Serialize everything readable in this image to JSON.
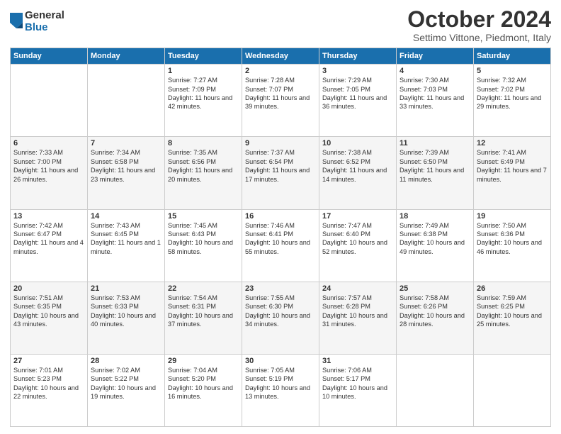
{
  "logo": {
    "general": "General",
    "blue": "Blue"
  },
  "title": "October 2024",
  "subtitle": "Settimo Vittone, Piedmont, Italy",
  "days_of_week": [
    "Sunday",
    "Monday",
    "Tuesday",
    "Wednesday",
    "Thursday",
    "Friday",
    "Saturday"
  ],
  "weeks": [
    [
      {
        "day": "",
        "sunrise": "",
        "sunset": "",
        "daylight": ""
      },
      {
        "day": "",
        "sunrise": "",
        "sunset": "",
        "daylight": ""
      },
      {
        "day": "1",
        "sunrise": "Sunrise: 7:27 AM",
        "sunset": "Sunset: 7:09 PM",
        "daylight": "Daylight: 11 hours and 42 minutes."
      },
      {
        "day": "2",
        "sunrise": "Sunrise: 7:28 AM",
        "sunset": "Sunset: 7:07 PM",
        "daylight": "Daylight: 11 hours and 39 minutes."
      },
      {
        "day": "3",
        "sunrise": "Sunrise: 7:29 AM",
        "sunset": "Sunset: 7:05 PM",
        "daylight": "Daylight: 11 hours and 36 minutes."
      },
      {
        "day": "4",
        "sunrise": "Sunrise: 7:30 AM",
        "sunset": "Sunset: 7:03 PM",
        "daylight": "Daylight: 11 hours and 33 minutes."
      },
      {
        "day": "5",
        "sunrise": "Sunrise: 7:32 AM",
        "sunset": "Sunset: 7:02 PM",
        "daylight": "Daylight: 11 hours and 29 minutes."
      }
    ],
    [
      {
        "day": "6",
        "sunrise": "Sunrise: 7:33 AM",
        "sunset": "Sunset: 7:00 PM",
        "daylight": "Daylight: 11 hours and 26 minutes."
      },
      {
        "day": "7",
        "sunrise": "Sunrise: 7:34 AM",
        "sunset": "Sunset: 6:58 PM",
        "daylight": "Daylight: 11 hours and 23 minutes."
      },
      {
        "day": "8",
        "sunrise": "Sunrise: 7:35 AM",
        "sunset": "Sunset: 6:56 PM",
        "daylight": "Daylight: 11 hours and 20 minutes."
      },
      {
        "day": "9",
        "sunrise": "Sunrise: 7:37 AM",
        "sunset": "Sunset: 6:54 PM",
        "daylight": "Daylight: 11 hours and 17 minutes."
      },
      {
        "day": "10",
        "sunrise": "Sunrise: 7:38 AM",
        "sunset": "Sunset: 6:52 PM",
        "daylight": "Daylight: 11 hours and 14 minutes."
      },
      {
        "day": "11",
        "sunrise": "Sunrise: 7:39 AM",
        "sunset": "Sunset: 6:50 PM",
        "daylight": "Daylight: 11 hours and 11 minutes."
      },
      {
        "day": "12",
        "sunrise": "Sunrise: 7:41 AM",
        "sunset": "Sunset: 6:49 PM",
        "daylight": "Daylight: 11 hours and 7 minutes."
      }
    ],
    [
      {
        "day": "13",
        "sunrise": "Sunrise: 7:42 AM",
        "sunset": "Sunset: 6:47 PM",
        "daylight": "Daylight: 11 hours and 4 minutes."
      },
      {
        "day": "14",
        "sunrise": "Sunrise: 7:43 AM",
        "sunset": "Sunset: 6:45 PM",
        "daylight": "Daylight: 11 hours and 1 minute."
      },
      {
        "day": "15",
        "sunrise": "Sunrise: 7:45 AM",
        "sunset": "Sunset: 6:43 PM",
        "daylight": "Daylight: 10 hours and 58 minutes."
      },
      {
        "day": "16",
        "sunrise": "Sunrise: 7:46 AM",
        "sunset": "Sunset: 6:41 PM",
        "daylight": "Daylight: 10 hours and 55 minutes."
      },
      {
        "day": "17",
        "sunrise": "Sunrise: 7:47 AM",
        "sunset": "Sunset: 6:40 PM",
        "daylight": "Daylight: 10 hours and 52 minutes."
      },
      {
        "day": "18",
        "sunrise": "Sunrise: 7:49 AM",
        "sunset": "Sunset: 6:38 PM",
        "daylight": "Daylight: 10 hours and 49 minutes."
      },
      {
        "day": "19",
        "sunrise": "Sunrise: 7:50 AM",
        "sunset": "Sunset: 6:36 PM",
        "daylight": "Daylight: 10 hours and 46 minutes."
      }
    ],
    [
      {
        "day": "20",
        "sunrise": "Sunrise: 7:51 AM",
        "sunset": "Sunset: 6:35 PM",
        "daylight": "Daylight: 10 hours and 43 minutes."
      },
      {
        "day": "21",
        "sunrise": "Sunrise: 7:53 AM",
        "sunset": "Sunset: 6:33 PM",
        "daylight": "Daylight: 10 hours and 40 minutes."
      },
      {
        "day": "22",
        "sunrise": "Sunrise: 7:54 AM",
        "sunset": "Sunset: 6:31 PM",
        "daylight": "Daylight: 10 hours and 37 minutes."
      },
      {
        "day": "23",
        "sunrise": "Sunrise: 7:55 AM",
        "sunset": "Sunset: 6:30 PM",
        "daylight": "Daylight: 10 hours and 34 minutes."
      },
      {
        "day": "24",
        "sunrise": "Sunrise: 7:57 AM",
        "sunset": "Sunset: 6:28 PM",
        "daylight": "Daylight: 10 hours and 31 minutes."
      },
      {
        "day": "25",
        "sunrise": "Sunrise: 7:58 AM",
        "sunset": "Sunset: 6:26 PM",
        "daylight": "Daylight: 10 hours and 28 minutes."
      },
      {
        "day": "26",
        "sunrise": "Sunrise: 7:59 AM",
        "sunset": "Sunset: 6:25 PM",
        "daylight": "Daylight: 10 hours and 25 minutes."
      }
    ],
    [
      {
        "day": "27",
        "sunrise": "Sunrise: 7:01 AM",
        "sunset": "Sunset: 5:23 PM",
        "daylight": "Daylight: 10 hours and 22 minutes."
      },
      {
        "day": "28",
        "sunrise": "Sunrise: 7:02 AM",
        "sunset": "Sunset: 5:22 PM",
        "daylight": "Daylight: 10 hours and 19 minutes."
      },
      {
        "day": "29",
        "sunrise": "Sunrise: 7:04 AM",
        "sunset": "Sunset: 5:20 PM",
        "daylight": "Daylight: 10 hours and 16 minutes."
      },
      {
        "day": "30",
        "sunrise": "Sunrise: 7:05 AM",
        "sunset": "Sunset: 5:19 PM",
        "daylight": "Daylight: 10 hours and 13 minutes."
      },
      {
        "day": "31",
        "sunrise": "Sunrise: 7:06 AM",
        "sunset": "Sunset: 5:17 PM",
        "daylight": "Daylight: 10 hours and 10 minutes."
      },
      {
        "day": "",
        "sunrise": "",
        "sunset": "",
        "daylight": ""
      },
      {
        "day": "",
        "sunrise": "",
        "sunset": "",
        "daylight": ""
      }
    ]
  ]
}
